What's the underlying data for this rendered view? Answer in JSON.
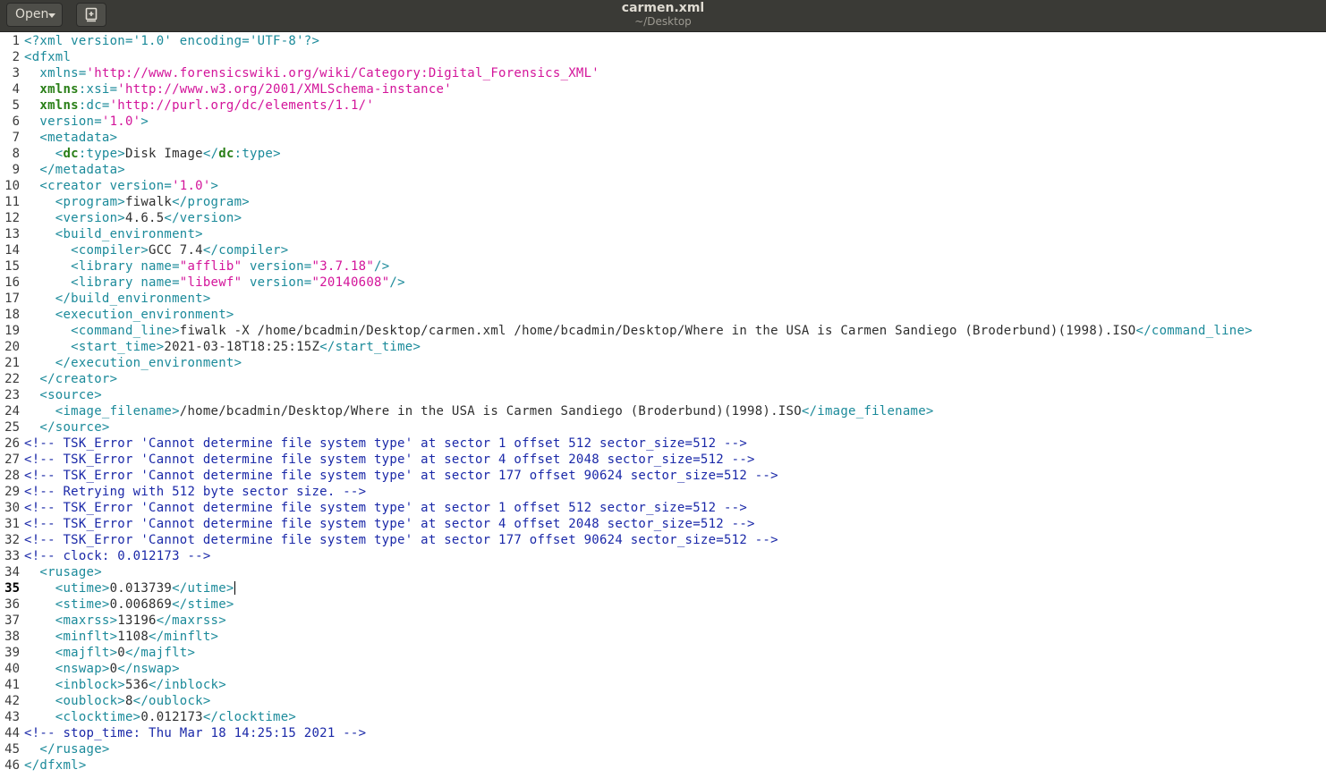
{
  "window": {
    "title": "carmen.xml",
    "subtitle": "~/Desktop",
    "open_label": "Open"
  },
  "icons": {
    "open_dropdown": "chevron-down-icon",
    "new_document": "new-document-icon"
  },
  "editor": {
    "current_line": 35,
    "lines": [
      {
        "n": "1",
        "segs": [
          {
            "c": "tag",
            "t": "<?xml version='1.0' encoding='UTF-8'?>"
          }
        ]
      },
      {
        "n": "2",
        "segs": [
          {
            "c": "tag",
            "t": "<dfxml"
          }
        ]
      },
      {
        "n": "3",
        "segs": [
          {
            "c": "attr",
            "t": "  xmlns="
          },
          {
            "c": "val",
            "t": "'http://www.forensicswiki.org/wiki/Category:Digital_Forensics_XML'"
          }
        ]
      },
      {
        "n": "4",
        "segs": [
          {
            "c": "ns",
            "t": "  xmlns"
          },
          {
            "c": "attr",
            "t": ":xsi="
          },
          {
            "c": "val",
            "t": "'http://www.w3.org/2001/XMLSchema-instance'"
          }
        ]
      },
      {
        "n": "5",
        "segs": [
          {
            "c": "ns",
            "t": "  xmlns"
          },
          {
            "c": "attr",
            "t": ":dc="
          },
          {
            "c": "val",
            "t": "'http://purl.org/dc/elements/1.1/'"
          }
        ]
      },
      {
        "n": "6",
        "segs": [
          {
            "c": "attr",
            "t": "  version="
          },
          {
            "c": "val",
            "t": "'1.0'"
          },
          {
            "c": "tag",
            "t": ">"
          }
        ]
      },
      {
        "n": "7",
        "segs": [
          {
            "c": "tag",
            "t": "  <metadata>"
          }
        ]
      },
      {
        "n": "8",
        "segs": [
          {
            "c": "tag",
            "t": "    <"
          },
          {
            "c": "ns",
            "t": "dc"
          },
          {
            "c": "tag",
            "t": ":type>"
          },
          {
            "c": "txt",
            "t": "Disk Image"
          },
          {
            "c": "tag",
            "t": "</"
          },
          {
            "c": "ns",
            "t": "dc"
          },
          {
            "c": "tag",
            "t": ":type>"
          }
        ]
      },
      {
        "n": "9",
        "segs": [
          {
            "c": "tag",
            "t": "  </metadata>"
          }
        ]
      },
      {
        "n": "10",
        "segs": [
          {
            "c": "tag",
            "t": "  <creator version="
          },
          {
            "c": "val",
            "t": "'1.0'"
          },
          {
            "c": "tag",
            "t": ">"
          }
        ]
      },
      {
        "n": "11",
        "segs": [
          {
            "c": "tag",
            "t": "    <program>"
          },
          {
            "c": "txt",
            "t": "fiwalk"
          },
          {
            "c": "tag",
            "t": "</program>"
          }
        ]
      },
      {
        "n": "12",
        "segs": [
          {
            "c": "tag",
            "t": "    <version>"
          },
          {
            "c": "txt",
            "t": "4.6.5"
          },
          {
            "c": "tag",
            "t": "</version>"
          }
        ]
      },
      {
        "n": "13",
        "segs": [
          {
            "c": "tag",
            "t": "    <build_environment>"
          }
        ]
      },
      {
        "n": "14",
        "segs": [
          {
            "c": "tag",
            "t": "      <compiler>"
          },
          {
            "c": "txt",
            "t": "GCC 7.4"
          },
          {
            "c": "tag",
            "t": "</compiler>"
          }
        ]
      },
      {
        "n": "15",
        "segs": [
          {
            "c": "tag",
            "t": "      <library name="
          },
          {
            "c": "val",
            "t": "\"afflib\""
          },
          {
            "c": "tag",
            "t": " version="
          },
          {
            "c": "val",
            "t": "\"3.7.18\""
          },
          {
            "c": "tag",
            "t": "/>"
          }
        ]
      },
      {
        "n": "16",
        "segs": [
          {
            "c": "tag",
            "t": "      <library name="
          },
          {
            "c": "val",
            "t": "\"libewf\""
          },
          {
            "c": "tag",
            "t": " version="
          },
          {
            "c": "val",
            "t": "\"20140608\""
          },
          {
            "c": "tag",
            "t": "/>"
          }
        ]
      },
      {
        "n": "17",
        "segs": [
          {
            "c": "tag",
            "t": "    </build_environment>"
          }
        ]
      },
      {
        "n": "18",
        "segs": [
          {
            "c": "tag",
            "t": "    <execution_environment>"
          }
        ]
      },
      {
        "n": "19",
        "segs": [
          {
            "c": "tag",
            "t": "      <command_line>"
          },
          {
            "c": "txt",
            "t": "fiwalk -X /home/bcadmin/Desktop/carmen.xml /home/bcadmin/Desktop/Where in the USA is Carmen Sandiego (Broderbund)(1998).ISO"
          },
          {
            "c": "tag",
            "t": "</command_line>"
          }
        ]
      },
      {
        "n": "20",
        "segs": [
          {
            "c": "tag",
            "t": "      <start_time>"
          },
          {
            "c": "txt",
            "t": "2021-03-18T18:25:15Z"
          },
          {
            "c": "tag",
            "t": "</start_time>"
          }
        ]
      },
      {
        "n": "21",
        "segs": [
          {
            "c": "tag",
            "t": "    </execution_environment>"
          }
        ]
      },
      {
        "n": "22",
        "segs": [
          {
            "c": "tag",
            "t": "  </creator>"
          }
        ]
      },
      {
        "n": "23",
        "segs": [
          {
            "c": "tag",
            "t": "  <source>"
          }
        ]
      },
      {
        "n": "24",
        "segs": [
          {
            "c": "tag",
            "t": "    <image_filename>"
          },
          {
            "c": "txt",
            "t": "/home/bcadmin/Desktop/Where in the USA is Carmen Sandiego (Broderbund)(1998).ISO"
          },
          {
            "c": "tag",
            "t": "</image_filename>"
          }
        ]
      },
      {
        "n": "25",
        "segs": [
          {
            "c": "tag",
            "t": "  </source>"
          }
        ]
      },
      {
        "n": "26",
        "segs": [
          {
            "c": "cmt",
            "t": "<!-- TSK_Error 'Cannot determine file system type' at sector 1 offset 512 sector_size=512 -->"
          }
        ]
      },
      {
        "n": "27",
        "segs": [
          {
            "c": "cmt",
            "t": "<!-- TSK_Error 'Cannot determine file system type' at sector 4 offset 2048 sector_size=512 -->"
          }
        ]
      },
      {
        "n": "28",
        "segs": [
          {
            "c": "cmt",
            "t": "<!-- TSK_Error 'Cannot determine file system type' at sector 177 offset 90624 sector_size=512 -->"
          }
        ]
      },
      {
        "n": "29",
        "segs": [
          {
            "c": "cmt",
            "t": "<!-- Retrying with 512 byte sector size. -->"
          }
        ]
      },
      {
        "n": "30",
        "segs": [
          {
            "c": "cmt",
            "t": "<!-- TSK_Error 'Cannot determine file system type' at sector 1 offset 512 sector_size=512 -->"
          }
        ]
      },
      {
        "n": "31",
        "segs": [
          {
            "c": "cmt",
            "t": "<!-- TSK_Error 'Cannot determine file system type' at sector 4 offset 2048 sector_size=512 -->"
          }
        ]
      },
      {
        "n": "32",
        "segs": [
          {
            "c": "cmt",
            "t": "<!-- TSK_Error 'Cannot determine file system type' at sector 177 offset 90624 sector_size=512 -->"
          }
        ]
      },
      {
        "n": "33",
        "segs": [
          {
            "c": "cmt",
            "t": "<!-- clock: 0.012173 -->"
          }
        ]
      },
      {
        "n": "34",
        "segs": [
          {
            "c": "tag",
            "t": "  <rusage>"
          }
        ]
      },
      {
        "n": "35",
        "segs": [
          {
            "c": "tag",
            "t": "    <utime>"
          },
          {
            "c": "txt",
            "t": "0.013739"
          },
          {
            "c": "tag",
            "t": "</utime>"
          }
        ]
      },
      {
        "n": "36",
        "segs": [
          {
            "c": "tag",
            "t": "    <stime>"
          },
          {
            "c": "txt",
            "t": "0.006869"
          },
          {
            "c": "tag",
            "t": "</stime>"
          }
        ]
      },
      {
        "n": "37",
        "segs": [
          {
            "c": "tag",
            "t": "    <maxrss>"
          },
          {
            "c": "txt",
            "t": "13196"
          },
          {
            "c": "tag",
            "t": "</maxrss>"
          }
        ]
      },
      {
        "n": "38",
        "segs": [
          {
            "c": "tag",
            "t": "    <minflt>"
          },
          {
            "c": "txt",
            "t": "1108"
          },
          {
            "c": "tag",
            "t": "</minflt>"
          }
        ]
      },
      {
        "n": "39",
        "segs": [
          {
            "c": "tag",
            "t": "    <majflt>"
          },
          {
            "c": "txt",
            "t": "0"
          },
          {
            "c": "tag",
            "t": "</majflt>"
          }
        ]
      },
      {
        "n": "40",
        "segs": [
          {
            "c": "tag",
            "t": "    <nswap>"
          },
          {
            "c": "txt",
            "t": "0"
          },
          {
            "c": "tag",
            "t": "</nswap>"
          }
        ]
      },
      {
        "n": "41",
        "segs": [
          {
            "c": "tag",
            "t": "    <inblock>"
          },
          {
            "c": "txt",
            "t": "536"
          },
          {
            "c": "tag",
            "t": "</inblock>"
          }
        ]
      },
      {
        "n": "42",
        "segs": [
          {
            "c": "tag",
            "t": "    <oublock>"
          },
          {
            "c": "txt",
            "t": "8"
          },
          {
            "c": "tag",
            "t": "</oublock>"
          }
        ]
      },
      {
        "n": "43",
        "segs": [
          {
            "c": "tag",
            "t": "    <clocktime>"
          },
          {
            "c": "txt",
            "t": "0.012173"
          },
          {
            "c": "tag",
            "t": "</clocktime>"
          }
        ]
      },
      {
        "n": "44",
        "segs": [
          {
            "c": "cmt",
            "t": "<!-- stop_time: Thu Mar 18 14:25:15 2021 -->"
          }
        ]
      },
      {
        "n": "45",
        "segs": [
          {
            "c": "tag",
            "t": "  </rusage>"
          }
        ]
      },
      {
        "n": "46",
        "segs": [
          {
            "c": "tag",
            "t": "</dfxml>"
          }
        ]
      }
    ]
  }
}
